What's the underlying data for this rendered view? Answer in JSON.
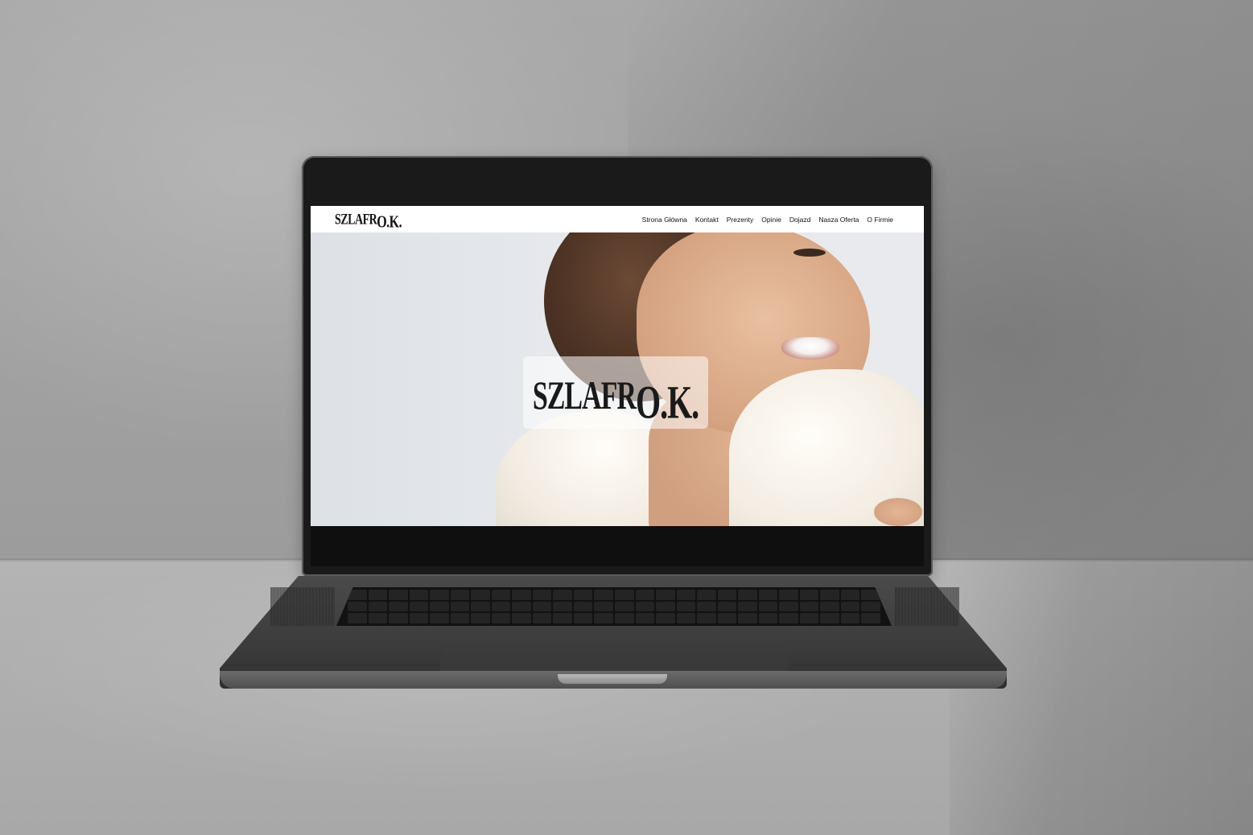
{
  "site": {
    "logo": {
      "main": "SZLAFR",
      "suffix": "O.K."
    },
    "nav": [
      {
        "label": "Strona Główna"
      },
      {
        "label": "Kontakt"
      },
      {
        "label": "Prezenty"
      },
      {
        "label": "Opinie"
      },
      {
        "label": "Dojazd"
      },
      {
        "label": "Nasza Oferta"
      },
      {
        "label": "O Firmie"
      }
    ],
    "hero": {
      "logo": {
        "main": "SZLAFR",
        "suffix": "O.K."
      }
    }
  },
  "colors": {
    "header_bg": "#ffffff",
    "text": "#111111",
    "laptop_body": "#3a3a3a",
    "wall": "#a9a9a9"
  }
}
